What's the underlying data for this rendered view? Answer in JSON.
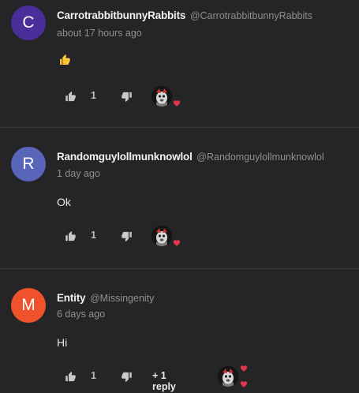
{
  "comments": [
    {
      "avatar_letter": "C",
      "avatar_color": "#4a2e9a",
      "author": "CarrotrabbitbunnyRabbits",
      "handle": "@CarrotrabbitbunnyRabbits",
      "time": "about 17 hours ago",
      "body_emoji": "thumbs-up-emoji",
      "like_count": "1",
      "has_creator_heart": true
    },
    {
      "avatar_letter": "R",
      "avatar_color": "#5865b8",
      "author": "Randomguylollmunknowlol",
      "handle": "@Randomguylollmunknowlol",
      "time": "1 day ago",
      "body": "Ok",
      "like_count": "1",
      "has_creator_heart": true
    },
    {
      "avatar_letter": "M",
      "avatar_color": "#f0522c",
      "author": "Entity",
      "handle": "@Missingenity",
      "time": "6 days ago",
      "body": "Hi",
      "like_count": "1",
      "reply_label": "+ 1 reply",
      "has_creator_heart": true
    }
  ],
  "colors": {
    "background": "#252527",
    "heart": "#e0364b",
    "muted_text": "#8f8f92"
  },
  "icons": {
    "like": "thumbs-up-icon",
    "dislike": "thumbs-down-icon",
    "creator_heart": "heart-icon"
  }
}
